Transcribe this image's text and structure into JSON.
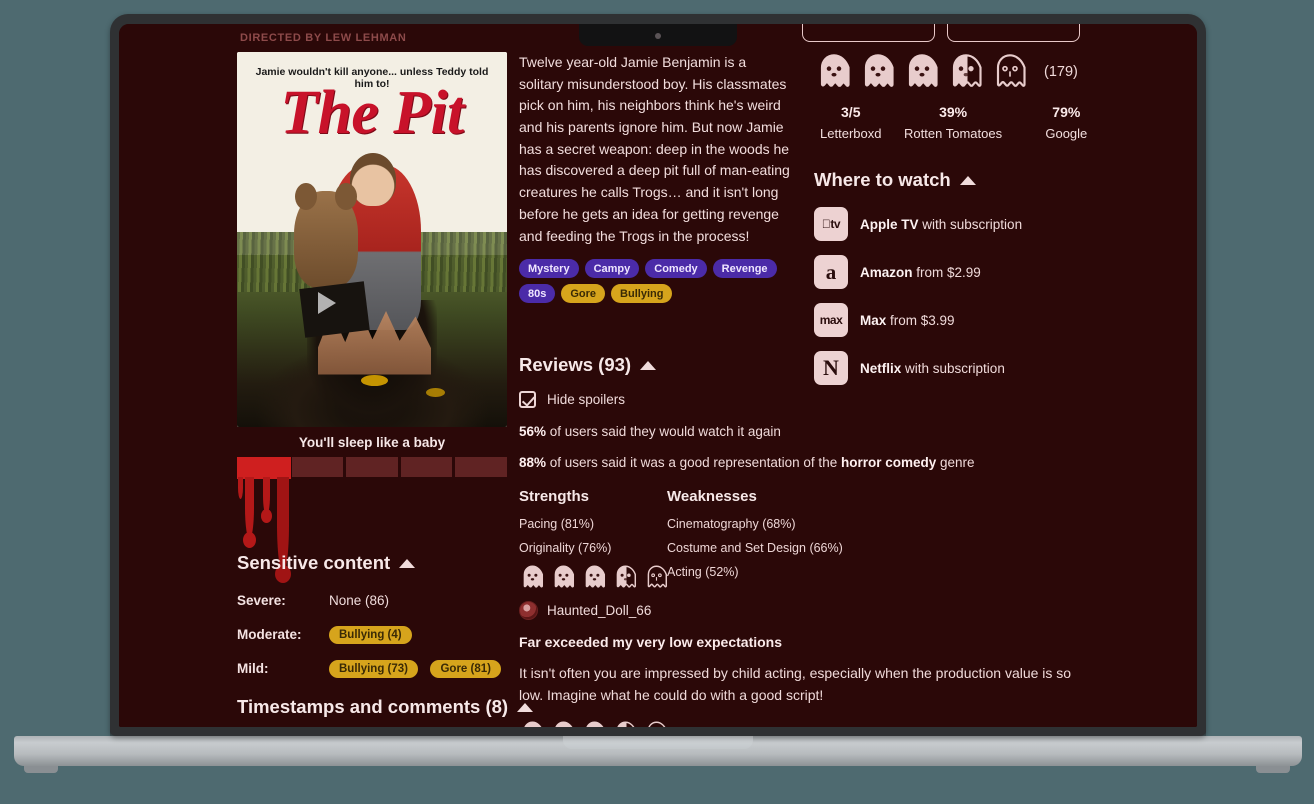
{
  "movie": {
    "directed_by": "DIRECTED BY LEW LEHMAN",
    "poster_tagline_top": "Jamie wouldn't kill anyone... unless Teddy told him to!",
    "poster_title": "The Pit",
    "tagline": "You'll sleep like a baby",
    "synopsis": "Twelve year-old Jamie Benjamin is a solitary misunderstood boy. His classmates pick on him, his neighbors think he's weird and his parents ignore him. But now Jamie has a secret weapon: deep in the woods he has discovered a deep pit full of man-eating creatures he calls Trogs… and it isn't long before he gets an idea for getting revenge and feeding the Trogs in the process!",
    "tags": [
      {
        "label": "Mystery",
        "kind": "genre"
      },
      {
        "label": "Campy",
        "kind": "genre"
      },
      {
        "label": "Comedy",
        "kind": "genre"
      },
      {
        "label": "Revenge",
        "kind": "genre"
      },
      {
        "label": "80s",
        "kind": "genre"
      },
      {
        "label": "Gore",
        "kind": "warning"
      },
      {
        "label": "Bullying",
        "kind": "warning"
      }
    ]
  },
  "top_buttons": [
    {
      "label": ""
    },
    {
      "label": ""
    }
  ],
  "rating": {
    "ghosts_filled": 3,
    "ghosts_half": 1,
    "ghosts_total": 5,
    "count": "(179)",
    "sources": [
      {
        "value": "3/5",
        "name": "Letterboxd"
      },
      {
        "value": "39%",
        "name": "Rotten Tomatoes"
      },
      {
        "value": "79%",
        "name": "Google"
      }
    ]
  },
  "where_to_watch": {
    "title": "Where to watch",
    "providers": [
      {
        "logo": "tv",
        "logo_text": " tv",
        "name": "Apple TV",
        "terms": "with subscription"
      },
      {
        "logo": "a",
        "logo_text": "a",
        "name": "Amazon",
        "terms": "from $2.99"
      },
      {
        "logo": "m",
        "logo_text": "max",
        "name": "Max",
        "terms": "from $3.99"
      },
      {
        "logo": "n",
        "logo_text": "N",
        "name": "Netflix",
        "terms": "with subscription"
      }
    ]
  },
  "reviews": {
    "title": "Reviews (93)",
    "hide_spoilers_label": "Hide spoilers",
    "hide_spoilers_checked": true,
    "stat_watch_again_pct": "56%",
    "stat_watch_again_rest": " of users said they would watch it again",
    "stat_genre_pct": "88%",
    "stat_genre_mid": " of users said it was a good representation of the ",
    "stat_genre_bold": "horror comedy",
    "stat_genre_end": " genre",
    "strengths_header": "Strengths",
    "weaknesses_header": "Weaknesses",
    "strengths": [
      "Pacing (81%)",
      "Originality (76%)"
    ],
    "weaknesses": [
      "Cinematography (68%)",
      "Costume and Set Design (66%)",
      "Acting (52%)"
    ],
    "featured": {
      "ghosts_filled": 3,
      "ghosts_half": 1,
      "ghosts_total": 5,
      "username": "Haunted_Doll_66",
      "title": "Far exceeded my very low expectations",
      "body": "It isn't often you are impressed by child acting, especially when the production value is so low. Imagine what he could do with a good script!"
    },
    "next_review_ghosts_filled": 3,
    "next_review_ghosts_half": 1,
    "next_review_ghosts_total": 5
  },
  "sensitive_content": {
    "title": "Sensitive content",
    "rows": [
      {
        "level": "Severe:",
        "plain": "None (86)",
        "pills": []
      },
      {
        "level": "Moderate:",
        "plain": "",
        "pills": [
          "Bullying (4)"
        ]
      },
      {
        "level": "Mild:",
        "plain": "",
        "pills": [
          "Bullying (73)",
          "Gore (81)"
        ]
      }
    ]
  },
  "timestamps": {
    "title": "Timestamps and comments (8)"
  },
  "colors": {
    "page_bg": "#4e6a70",
    "screen_bg": "#2b0808",
    "accent_genre": "#4b2ba8",
    "accent_warning": "#d6a41c",
    "blood": "#cf1f1f",
    "text": "#f2dede"
  }
}
